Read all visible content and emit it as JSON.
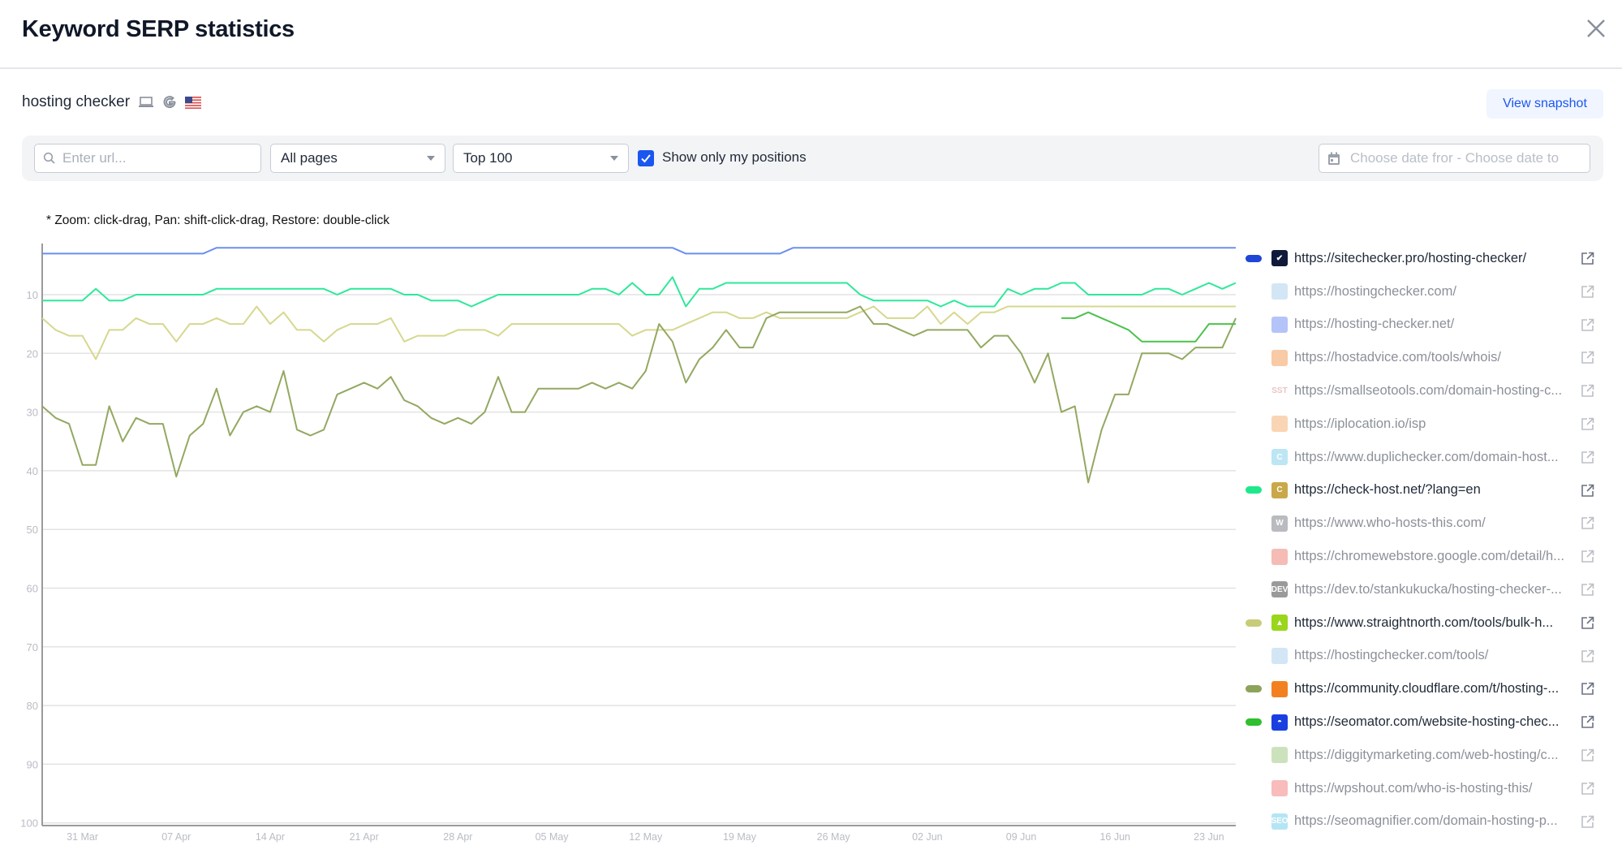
{
  "header": {
    "title": "Keyword SERP statistics",
    "close_icon": "close-icon"
  },
  "keyword": {
    "text": "hosting checker",
    "device_icon": "laptop-icon",
    "engine_icon": "google-icon",
    "country_icon": "us-flag-icon"
  },
  "view_snapshot_label": "View snapshot",
  "filters": {
    "url_placeholder": "Enter url...",
    "url_value": "",
    "pages_select": "All pages",
    "top_select": "Top 100",
    "only_mine_label": "Show only my positions",
    "only_mine_checked": true,
    "date_placeholder": "Choose date fror - Choose date to"
  },
  "chart_hint": "* Zoom: click-drag, Pan: shift-click-drag, Restore: double-click",
  "chart_data": {
    "type": "line",
    "y_reversed": true,
    "ylim": [
      0,
      100
    ],
    "y_ticks": [
      "10",
      "20",
      "30",
      "40",
      "50",
      "60",
      "70",
      "80",
      "90",
      "100"
    ],
    "x_ticks": [
      "31 Mar",
      "07 Apr",
      "14 Apr",
      "21 Apr",
      "28 Apr",
      "05 May",
      "12 May",
      "19 May",
      "26 May",
      "02 Jun",
      "09 Jun",
      "16 Jun",
      "23 Jun"
    ],
    "grid": true,
    "x": [
      "28 Mar",
      "29 Mar",
      "30 Mar",
      "31 Mar",
      "01 Apr",
      "02 Apr",
      "03 Apr",
      "04 Apr",
      "05 Apr",
      "06 Apr",
      "07 Apr",
      "08 Apr",
      "09 Apr",
      "10 Apr",
      "11 Apr",
      "12 Apr",
      "13 Apr",
      "14 Apr",
      "15 Apr",
      "16 Apr",
      "17 Apr",
      "18 Apr",
      "19 Apr",
      "20 Apr",
      "21 Apr",
      "22 Apr",
      "23 Apr",
      "24 Apr",
      "25 Apr",
      "26 Apr",
      "27 Apr",
      "28 Apr",
      "29 Apr",
      "30 Apr",
      "01 May",
      "02 May",
      "03 May",
      "04 May",
      "05 May",
      "06 May",
      "07 May",
      "08 May",
      "09 May",
      "10 May",
      "11 May",
      "12 May",
      "13 May",
      "14 May",
      "15 May",
      "16 May",
      "17 May",
      "18 May",
      "19 May",
      "20 May",
      "21 May",
      "22 May",
      "23 May",
      "24 May",
      "25 May",
      "26 May",
      "27 May",
      "28 May",
      "29 May",
      "30 May",
      "31 May",
      "01 Jun",
      "02 Jun",
      "03 Jun",
      "04 Jun",
      "05 Jun",
      "06 Jun",
      "07 Jun",
      "08 Jun",
      "09 Jun",
      "10 Jun",
      "11 Jun",
      "12 Jun",
      "13 Jun",
      "14 Jun",
      "15 Jun",
      "16 Jun",
      "17 Jun",
      "18 Jun",
      "19 Jun",
      "20 Jun",
      "21 Jun",
      "22 Jun",
      "23 Jun",
      "24 Jun",
      "25 Jun"
    ],
    "series": [
      {
        "name": "https://sitechecker.pro/hosting-checker/",
        "color": "#6b8ff0",
        "values": [
          3,
          3,
          3,
          3,
          3,
          3,
          3,
          3,
          3,
          3,
          3,
          3,
          3,
          2,
          2,
          2,
          2,
          2,
          2,
          2,
          2,
          2,
          2,
          2,
          2,
          2,
          2,
          2,
          2,
          2,
          2,
          2,
          2,
          2,
          2,
          2,
          2,
          2,
          2,
          2,
          2,
          2,
          2,
          2,
          2,
          2,
          2,
          2,
          3,
          3,
          3,
          3,
          3,
          3,
          3,
          3,
          2,
          2,
          2,
          2,
          2,
          2,
          2,
          2,
          2,
          2,
          2,
          2,
          2,
          2,
          2,
          2,
          2,
          2,
          2,
          2,
          2,
          2,
          2,
          2,
          2,
          2,
          2,
          2,
          2,
          2,
          2,
          2,
          2,
          2
        ]
      },
      {
        "name": "https://check-host.net/?lang=en",
        "color": "#2ee89a",
        "values": [
          11,
          11,
          11,
          11,
          9,
          11,
          11,
          10,
          10,
          10,
          10,
          10,
          10,
          9,
          9,
          9,
          9,
          9,
          9,
          9,
          9,
          9,
          10,
          9,
          9,
          9,
          9,
          10,
          10,
          11,
          11,
          11,
          12,
          11,
          10,
          10,
          10,
          10,
          10,
          10,
          10,
          9,
          9,
          10,
          8,
          10,
          10,
          7,
          12,
          9,
          9,
          8,
          8,
          8,
          8,
          8,
          8,
          8,
          8,
          8,
          8,
          10,
          11,
          11,
          11,
          11,
          11,
          12,
          11,
          12,
          12,
          12,
          9,
          10,
          9,
          9,
          8,
          8,
          10,
          10,
          10,
          10,
          10,
          9,
          9,
          10,
          9,
          8,
          9,
          8
        ]
      },
      {
        "name": "https://www.straightnorth.com/tools/bulk-h...",
        "color": "#d6d88f",
        "values": [
          14,
          16,
          17,
          17,
          21,
          16,
          16,
          14,
          15,
          15,
          18,
          15,
          15,
          14,
          15,
          15,
          12,
          15,
          13,
          16,
          16,
          18,
          16,
          15,
          15,
          15,
          14,
          18,
          17,
          17,
          17,
          16,
          16,
          16,
          17,
          15,
          15,
          15,
          15,
          15,
          15,
          15,
          15,
          15,
          17,
          16,
          16,
          16,
          15,
          14,
          13,
          13,
          14,
          14,
          13,
          14,
          14,
          14,
          14,
          14,
          14,
          13,
          12,
          14,
          14,
          14,
          12,
          15,
          13,
          15,
          13,
          13,
          12,
          12,
          12,
          12,
          12,
          12,
          12,
          12,
          12,
          12,
          12,
          12,
          12,
          12,
          12,
          12,
          12,
          12
        ]
      },
      {
        "name": "https://community.cloudflare.com/t/hosting-...",
        "color": "#93a861",
        "values": [
          29,
          31,
          32,
          39,
          39,
          29,
          35,
          31,
          32,
          32,
          41,
          34,
          32,
          26,
          34,
          30,
          29,
          30,
          23,
          33,
          34,
          33,
          27,
          26,
          25,
          26,
          24,
          28,
          29,
          31,
          32,
          31,
          32,
          30,
          24,
          30,
          30,
          26,
          26,
          26,
          26,
          25,
          26,
          25,
          26,
          23,
          15,
          18,
          25,
          21,
          19,
          16,
          19,
          19,
          14,
          13,
          13,
          13,
          13,
          13,
          13,
          12,
          15,
          15,
          16,
          17,
          16,
          16,
          16,
          16,
          19,
          17,
          17,
          20,
          25,
          20,
          30,
          29,
          42,
          33,
          27,
          27,
          20,
          20,
          20,
          21,
          19,
          19,
          19,
          14
        ]
      },
      {
        "name": "https://seomator.com/website-hosting-chec...",
        "color": "#4cc24c",
        "values": [
          null,
          null,
          null,
          null,
          null,
          null,
          null,
          null,
          null,
          null,
          null,
          null,
          null,
          null,
          null,
          null,
          null,
          null,
          null,
          null,
          null,
          null,
          null,
          null,
          null,
          null,
          null,
          null,
          null,
          null,
          null,
          null,
          null,
          null,
          null,
          null,
          null,
          null,
          null,
          null,
          null,
          null,
          null,
          null,
          null,
          null,
          null,
          null,
          null,
          null,
          null,
          null,
          null,
          null,
          null,
          null,
          null,
          null,
          null,
          null,
          null,
          null,
          null,
          null,
          null,
          null,
          null,
          null,
          null,
          null,
          null,
          null,
          null,
          null,
          null,
          null,
          14,
          14,
          13,
          14,
          15,
          16,
          18,
          18,
          18,
          18,
          18,
          15,
          15,
          15
        ]
      }
    ]
  },
  "legend": [
    {
      "url": "https://sitechecker.pro/hosting-checker/",
      "color": "#1f46d6",
      "active": true,
      "favicon": "sitechecker-icon",
      "fav_color": "#0f1a3a",
      "fav_text": "✔"
    },
    {
      "url": "https://hostingchecker.com/",
      "color": null,
      "active": false,
      "favicon": "hostingchecker-icon",
      "fav_color": "#9ec7e8",
      "fav_text": ""
    },
    {
      "url": "https://hosting-checker.net/",
      "color": null,
      "active": false,
      "favicon": "hosting-checker-net-icon",
      "fav_color": "#5a7cf0",
      "fav_text": ""
    },
    {
      "url": "https://hostadvice.com/tools/whois/",
      "color": null,
      "active": false,
      "favicon": "hostadvice-icon",
      "fav_color": "#f08a3a",
      "fav_text": ""
    },
    {
      "url": "https://smallseotools.com/domain-hosting-c...",
      "color": null,
      "active": false,
      "favicon": "smallseotools-icon",
      "fav_color": "#ffffff",
      "fav_text": "SST"
    },
    {
      "url": "https://iplocation.io/isp",
      "color": null,
      "active": false,
      "favicon": "iplocation-icon",
      "fav_color": "#f5a25a",
      "fav_text": ""
    },
    {
      "url": "https://www.duplichecker.com/domain-host...",
      "color": null,
      "active": false,
      "favicon": "duplichecker-icon",
      "fav_color": "#6fc9e8",
      "fav_text": "C"
    },
    {
      "url": "https://check-host.net/?lang=en",
      "color": "#1ee88c",
      "active": true,
      "favicon": "check-host-icon",
      "fav_color": "#c9a84a",
      "fav_text": "C"
    },
    {
      "url": "https://www.who-hosts-this.com/",
      "color": null,
      "active": false,
      "favicon": "who-hosts-this-icon",
      "fav_color": "#666a72",
      "fav_text": "W"
    },
    {
      "url": "https://chromewebstore.google.com/detail/h...",
      "color": null,
      "active": false,
      "favicon": "chrome-webstore-icon",
      "fav_color": "#e96a5a",
      "fav_text": ""
    },
    {
      "url": "https://dev.to/stankukucka/hosting-checker-...",
      "color": null,
      "active": false,
      "favicon": "dev-to-icon",
      "fav_color": "#222222",
      "fav_text": "DEV"
    },
    {
      "url": "https://www.straightnorth.com/tools/bulk-h...",
      "color": "#c8cc78",
      "active": true,
      "favicon": "straightnorth-icon",
      "fav_color": "#9ad61c",
      "fav_text": "▲"
    },
    {
      "url": "https://hostingchecker.com/tools/",
      "color": null,
      "active": false,
      "favicon": "hostingchecker-icon",
      "fav_color": "#9ec7e8",
      "fav_text": ""
    },
    {
      "url": "https://community.cloudflare.com/t/hosting-...",
      "color": "#8ca35a",
      "active": true,
      "favicon": "cloudflare-icon",
      "fav_color": "#f38020",
      "fav_text": ""
    },
    {
      "url": "https://seomator.com/website-hosting-chec...",
      "color": "#2fbf2f",
      "active": true,
      "favicon": "seomator-icon",
      "fav_color": "#1a3fe0",
      "fav_text": "◓"
    },
    {
      "url": "https://diggitymarketing.com/web-hosting/c...",
      "color": null,
      "active": false,
      "favicon": "diggitymarketing-icon",
      "fav_color": "#8fbf6a",
      "fav_text": ""
    },
    {
      "url": "https://wpshout.com/who-is-hosting-this/",
      "color": null,
      "active": false,
      "favicon": "wpshout-icon",
      "fav_color": "#f06a6a",
      "fav_text": ""
    },
    {
      "url": "https://seomagnifier.com/domain-hosting-p...",
      "color": null,
      "active": false,
      "favicon": "seomagnifier-icon",
      "fav_color": "#5cc6e8",
      "fav_text": "SEO"
    }
  ]
}
